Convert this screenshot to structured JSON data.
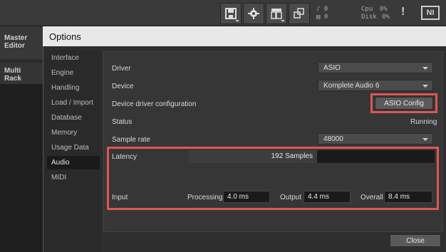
{
  "toolbar": {
    "meters": {
      "voices": "0",
      "memory": "0",
      "cpu_label": "Cpu",
      "cpu_value": "0%",
      "disk_label": "Disk",
      "disk_value": "0%"
    },
    "warning_symbol": "!",
    "logo_text": "NI"
  },
  "left_panel": {
    "master_editor": "Master\nEditor",
    "multi_rack": "Multi\nRack"
  },
  "dialog": {
    "title": "Options",
    "nav_items": [
      "Interface",
      "Engine",
      "Handling",
      "Load / Import",
      "Database",
      "Memory",
      "Usage Data",
      "Audio",
      "MIDI"
    ],
    "active_nav": "Audio",
    "driver": {
      "label": "Driver",
      "value": "ASIO"
    },
    "device": {
      "label": "Device",
      "value": "Komplete Audio 6"
    },
    "config": {
      "label": "Device driver configuration",
      "button": "ASIO Config"
    },
    "status": {
      "label": "Status",
      "value": "Running"
    },
    "sample_rate": {
      "label": "Sample rate",
      "value": "48000"
    },
    "latency": {
      "label": "Latency",
      "value": "192 Samples"
    },
    "input": {
      "label": "Input"
    },
    "processing": {
      "label": "Processing",
      "value": "4.0 ms"
    },
    "output": {
      "label": "Output",
      "value": "4.4 ms"
    },
    "overall": {
      "label": "Overall",
      "value": "8.4 ms"
    },
    "close_button": "Close"
  },
  "colors": {
    "highlight": "#e05555",
    "dialog_title_bg": "#e8e8e8"
  }
}
